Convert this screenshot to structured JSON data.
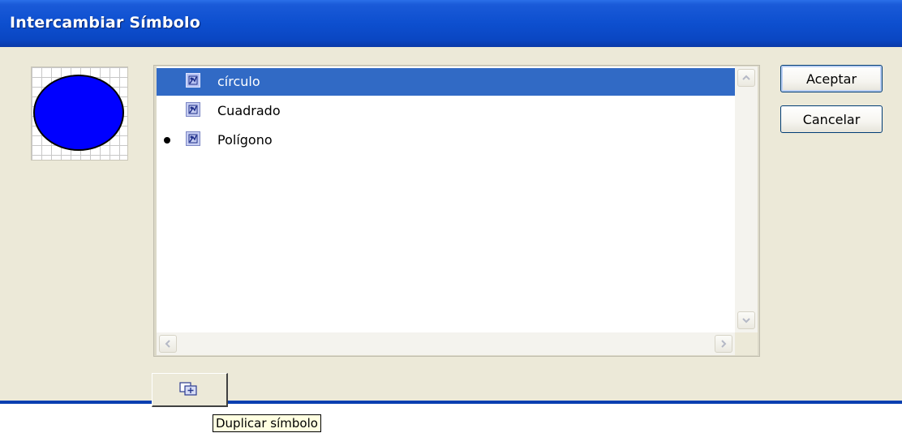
{
  "window": {
    "title": "Intercambiar Símbolo"
  },
  "preview": {
    "shape": "ellipse",
    "fill_color": "#0000ff",
    "stroke_color": "#000000"
  },
  "symbols": [
    {
      "label": "círculo",
      "selected": true,
      "current": false,
      "icon": "movie-clip-symbol-icon"
    },
    {
      "label": "Cuadrado",
      "selected": false,
      "current": false,
      "icon": "movie-clip-symbol-icon"
    },
    {
      "label": "Polígono",
      "selected": false,
      "current": true,
      "icon": "movie-clip-symbol-icon"
    }
  ],
  "buttons": {
    "ok_label": "Aceptar",
    "cancel_label": "Cancelar"
  },
  "duplicate": {
    "icon": "duplicate-symbol-icon",
    "tooltip": "Duplicar símbolo"
  },
  "colors": {
    "titlebar": "#0a46c2",
    "selection": "#316ac5",
    "dialog_bg": "#ece9d8"
  }
}
